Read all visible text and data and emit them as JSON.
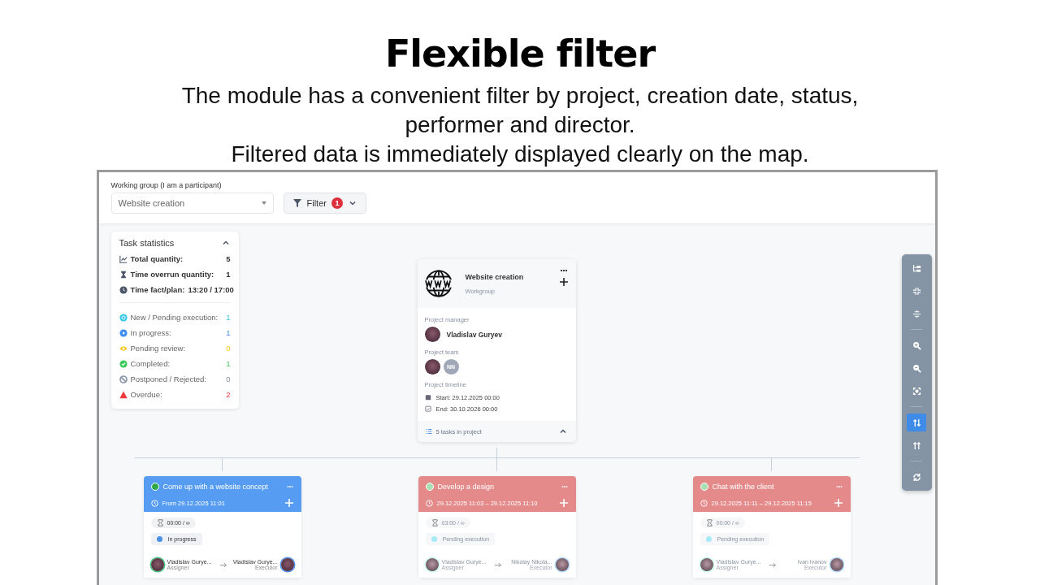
{
  "slide": {
    "title": "Flexible filter",
    "description": [
      "The module has a convenient filter by project, creation date, status, performer and director.",
      "Filtered data is immediately displayed clearly on the map."
    ]
  },
  "app": {
    "group_label": "Working group (I am a participant)",
    "group_select": {
      "value": "Website creation"
    },
    "filter_button": {
      "label": "Filter",
      "badge": "1"
    },
    "stats": {
      "title": "Task statistics",
      "expanded": true,
      "totals": [
        {
          "kind": "chart",
          "label": "Total quantity:",
          "value": "5"
        },
        {
          "kind": "hourglass",
          "label": "Time overrun quantity:",
          "value": "1"
        },
        {
          "kind": "clock",
          "label": "Time fact/plan:",
          "value": "13:20 / 17:00"
        }
      ],
      "statuses": [
        {
          "kind": "new",
          "label": "New / Pending execution:",
          "value": "1",
          "color": "#33c6e6"
        },
        {
          "kind": "play",
          "label": "In progress:",
          "value": "1",
          "color": "#3d8ef0"
        },
        {
          "kind": "eye",
          "label": "Pending review:",
          "value": "0",
          "color": "#f5c518"
        },
        {
          "kind": "check",
          "label": "Completed:",
          "value": "1",
          "color": "#3cc85c"
        },
        {
          "kind": "ban",
          "label": "Postponed / Rejected:",
          "value": "0",
          "color": "#8a94a6"
        },
        {
          "kind": "warn",
          "label": "Overdue:",
          "value": "2",
          "color": "#ef3b3b"
        }
      ]
    },
    "project": {
      "title": "Website creation",
      "subtitle": "Workgroup",
      "manager_label": "Project manager",
      "manager": "Vladislav Guryev",
      "team_label": "Project team",
      "team": [
        {
          "kind": "photo"
        },
        {
          "kind": "initials",
          "initials": "NN"
        }
      ],
      "timeline_label": "Project timeline",
      "start": "Start: 29.12.2025 00:00",
      "end": "End: 30.10.2026 00:00",
      "tasks": "5 tasks in project",
      "expanded": true
    },
    "tasks": [
      {
        "title": "Come up with a website concept",
        "time": "From 29.12.2025 11:01",
        "color": "#559cf2",
        "header_dot": {
          "color": "#2fa84a"
        },
        "dimmed": false,
        "timer": "00:00 / ∞",
        "status": {
          "text": "In progress",
          "color": "#4a90e2"
        },
        "assigner": "Vladislav Gurye...",
        "assigner_role": "Assigner",
        "executor": "Vladislav Gurye...",
        "executor_role": "Executor"
      },
      {
        "title": "Develop a design",
        "time": "29.12.2025 11:03 – 29.12.2025 11:10",
        "color": "#e58a8a",
        "header_dot": {
          "color": "#a8e0b4"
        },
        "dimmed": true,
        "timer": "03:00 / ∞",
        "status": {
          "text": "Pending execution",
          "color": "#a6e9f7"
        },
        "assigner": "Vladislav Gurye...",
        "assigner_role": "Assigner",
        "executor": "Nikolay Nikola...",
        "executor_role": "Executor"
      },
      {
        "title": "Chat with the client",
        "time": "29.12.2025 11:11 – 29.12.2025 11:15",
        "color": "#e58a8a",
        "header_dot": {
          "color": "#a8e0b4"
        },
        "dimmed": true,
        "timer": "00:00 / ∞",
        "status": {
          "text": "Pending execution",
          "color": "#a6e9f7"
        },
        "assigner": "Vladislav Gurye...",
        "assigner_role": "Assigner",
        "executor": "Ivan Ivanov",
        "executor_role": "Executor"
      }
    ],
    "toolbar": {
      "groups": [
        {
          "buttons": [
            {
              "kind": "tree",
              "selected": false
            },
            {
              "kind": "compress",
              "selected": false
            },
            {
              "kind": "center",
              "selected": false
            }
          ]
        },
        {
          "buttons": [
            {
              "kind": "zoom-in",
              "selected": false
            },
            {
              "kind": "zoom-out",
              "selected": false
            },
            {
              "kind": "fit",
              "selected": false
            }
          ]
        },
        {
          "buttons": [
            {
              "kind": "sort-down",
              "selected": true
            },
            {
              "kind": "sort-up",
              "selected": false
            }
          ]
        },
        {
          "buttons": [
            {
              "kind": "refresh",
              "selected": false
            }
          ]
        }
      ]
    }
  }
}
